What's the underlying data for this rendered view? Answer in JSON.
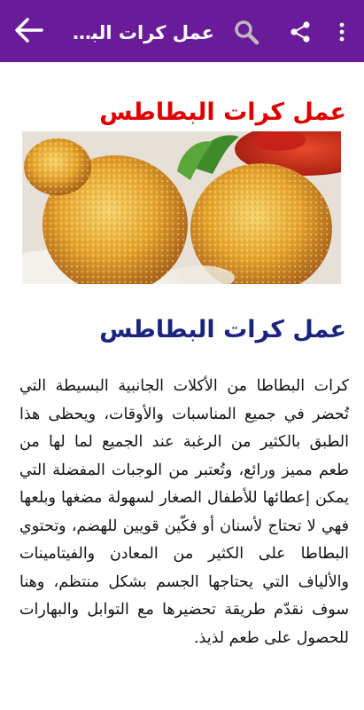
{
  "appbar": {
    "title": "عمل كرات البطاطس",
    "color": "#6A1B9A"
  },
  "article": {
    "heading_top": "عمل كرات البطاطس",
    "heading": "عمل كرات البطاطس",
    "body": "كرات البطاطا من الأكلات الجانبية البسيطة التي تُحضر في جميع المناسبات والأوقات، ويحظى هذا الطبق بالكثير من الرغبة عند الجميع لما لها من طعم مميز ورائع، وتُعتبر من الوجبات المفضلة التي يمكن إعطائها للأطفال الصغار لسهولة مضغها وبلعها فهي لا تحتاج لأسنان أو فكّين قويين للهضم، وتحتوي البطاطا على الكثير من المعادن والفيتامينات والألياف التي يحتاجها الجسم بشكل منتظم، وهنا سوف نقدّم طريقة تحضيرها مع التوابل والبهارات للحصول على طعم لذيذ."
  },
  "colors": {
    "heading_top": "#e00000",
    "heading": "#1a237e"
  },
  "icons": [
    "back-arrow-icon",
    "search-icon",
    "share-icon",
    "more-vert-icon"
  ]
}
